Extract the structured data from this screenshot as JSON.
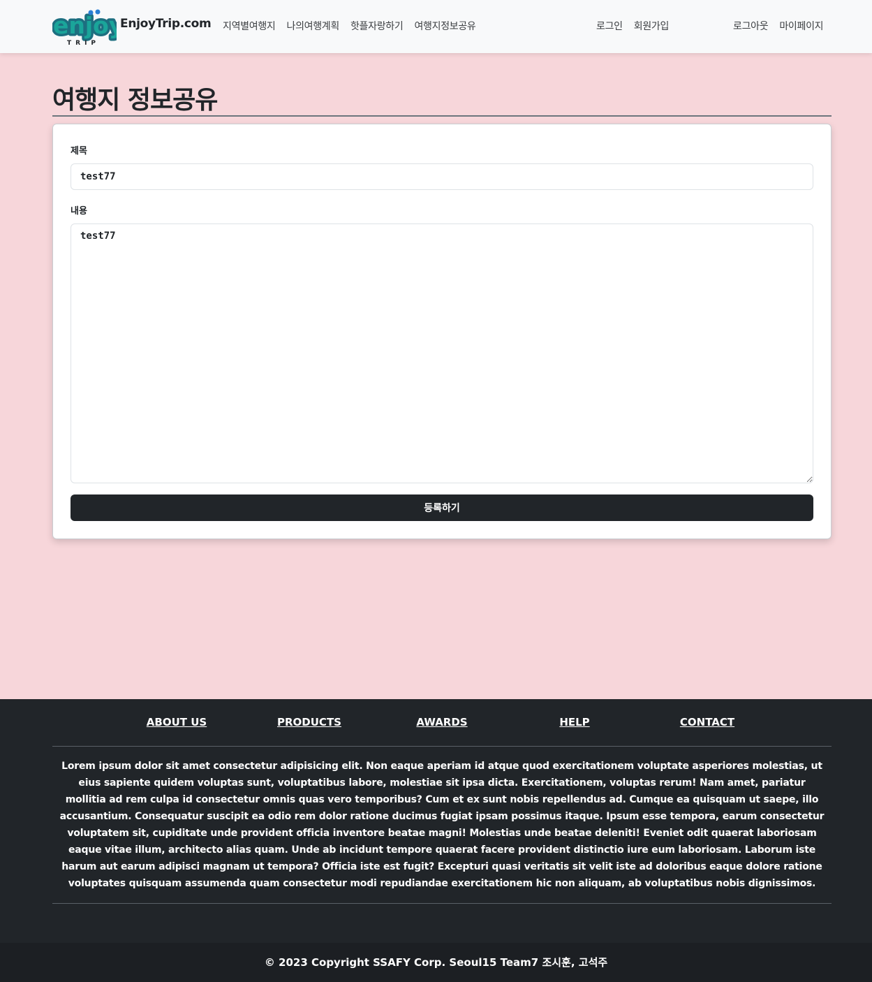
{
  "header": {
    "logo_text": "enjoy",
    "logo_sub": "TRIP",
    "brand": "EnjoyTrip.com",
    "nav": [
      "지역별여행지",
      "나의여행계획",
      "핫플자랑하기",
      "여행지정보공유"
    ],
    "guest_nav": [
      "로그인",
      "회원가입"
    ],
    "user_nav": [
      "로그아웃",
      "마이페이지"
    ]
  },
  "page": {
    "title": "여행지 정보공유"
  },
  "form": {
    "title_label": "제목",
    "title_value": "test77",
    "content_label": "내용",
    "content_value": "test77",
    "submit_label": "등록하기"
  },
  "footer": {
    "links": [
      "ABOUT US",
      "PRODUCTS",
      "AWARDS",
      "HELP",
      "CONTACT"
    ],
    "text": "Lorem ipsum dolor sit amet consectetur adipisicing elit. Non eaque aperiam id atque quod exercitationem voluptate asperiores molestias, ut eius sapiente quidem voluptas sunt, voluptatibus labore, molestiae sit ipsa dicta. Exercitationem, voluptas rerum! Nam amet, pariatur mollitia ad rem culpa id consectetur omnis quas vero temporibus? Cum et ex sunt nobis repellendus ad. Cumque ea quisquam ut saepe, illo accusantium. Consequatur suscipit ea odio rem dolor ratione ducimus fugiat ipsam possimus itaque. Ipsum esse tempora, earum consectetur voluptatem sit, cupiditate unde provident officia inventore beatae magni! Molestias unde beatae deleniti! Eveniet odit quaerat laboriosam eaque vitae illum, architecto alias quam. Unde ab incidunt tempore quaerat facere provident distinctio iure eum laboriosam. Laborum iste harum aut earum adipisci magnam ut tempora? Officia iste est fugit? Excepturi quasi veritatis sit velit iste ad doloribus eaque dolore ratione voluptates quisquam assumenda quam consectetur modi repudiandae exercitationem hic non aliquam, ab voluptatibus nobis dignissimos.",
    "copyright": "© 2023 Copyright SSAFY Corp. Seoul15 Team7 조시훈, 고석주"
  },
  "colors": {
    "page_bg": "#f7d6da",
    "navbar_bg": "#f8f9fa",
    "dark": "#212529",
    "logo_teal": "#1aa59a",
    "logo_blue": "#2a7fd4"
  }
}
